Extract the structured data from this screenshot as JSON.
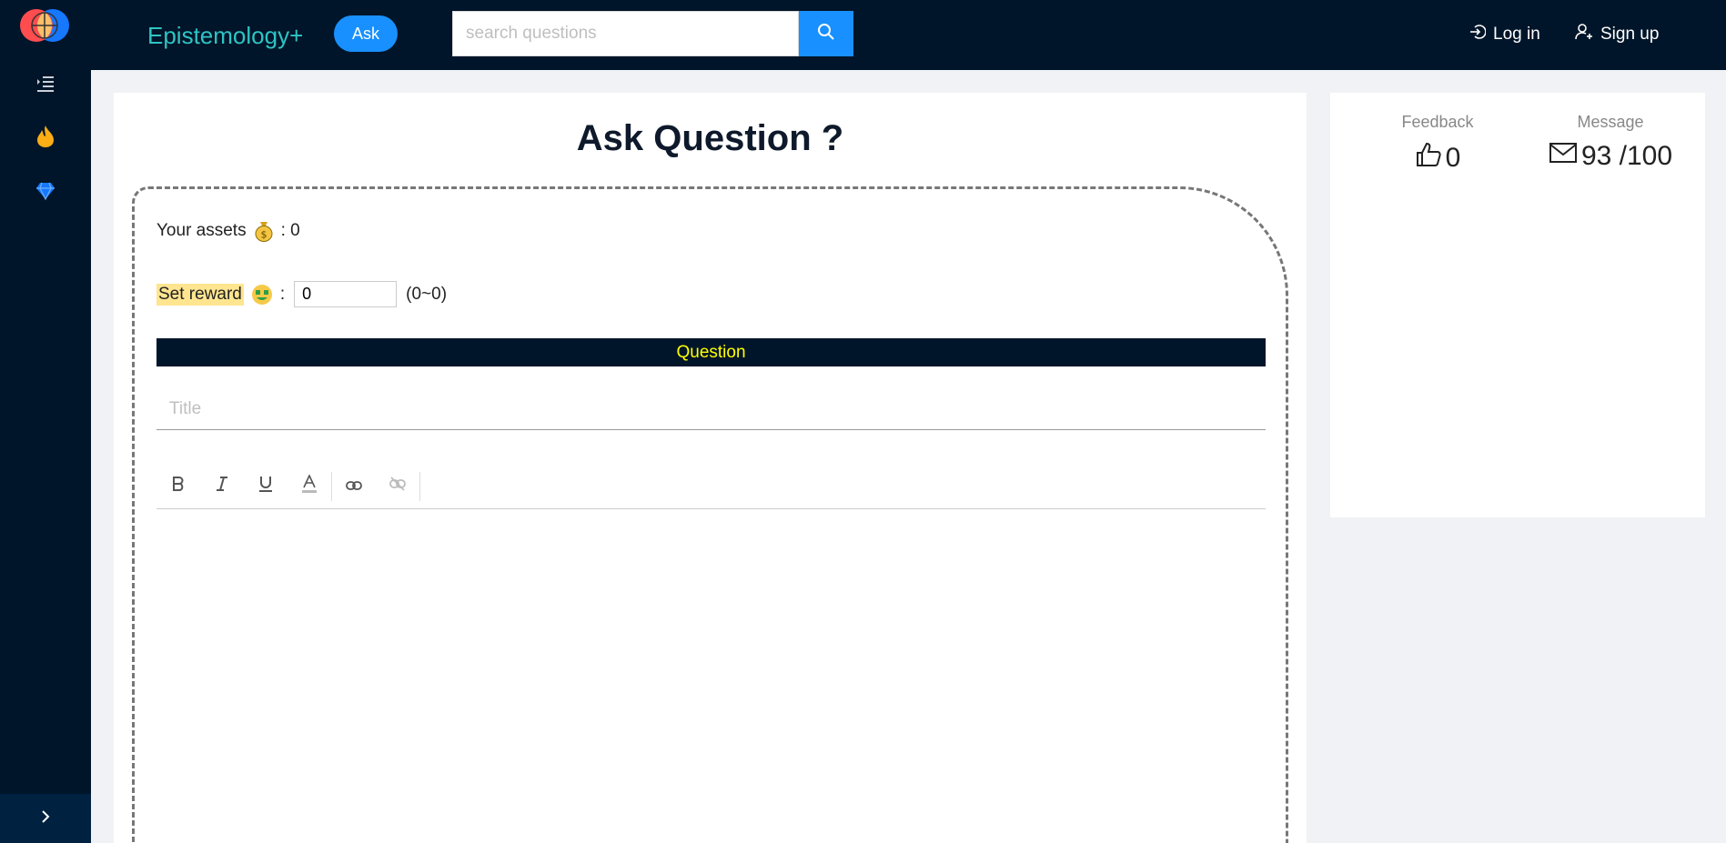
{
  "header": {
    "brand": "Epistemology+",
    "ask_label": "Ask",
    "search_placeholder": "search questions",
    "login_label": "Log in",
    "signup_label": "Sign up"
  },
  "sidebar": {
    "items": [
      {
        "icon": "menu-indent-icon"
      },
      {
        "icon": "fire-icon",
        "color": "#faad14"
      },
      {
        "icon": "diamond-icon",
        "color": "#1677ff"
      }
    ],
    "collapse_icon": "chevron-right-icon"
  },
  "main": {
    "title": "Ask Question ?",
    "assets_label": "Your assets",
    "assets_value": ": 0",
    "reward_label": "Set reward",
    "reward_colon": ":",
    "reward_value": "0",
    "reward_range": "(0~0)",
    "question_header": "Question",
    "title_placeholder": "Title",
    "toolbar": [
      "bold",
      "italic",
      "underline",
      "font-color",
      "link",
      "unlink"
    ]
  },
  "side": {
    "feedback_label": "Feedback",
    "feedback_value": "0",
    "message_label": "Message",
    "message_value": "93 /100"
  },
  "colors": {
    "nav": "#001529",
    "accent": "#1890ff",
    "brand": "#2ec4c4",
    "question_text": "#ffff00",
    "reward_highlight": "#ffe58f"
  }
}
